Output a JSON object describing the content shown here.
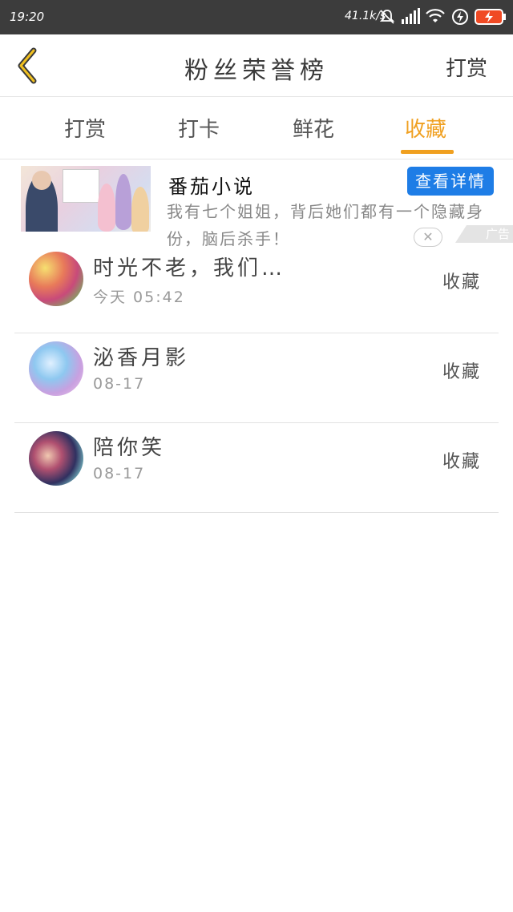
{
  "status_bar": {
    "time": "19:20",
    "network_speed": "41.1k/s",
    "icons": [
      "mute-bell-icon",
      "signal-icon",
      "wifi-icon",
      "data-saver-icon",
      "battery-charging-icon"
    ]
  },
  "header": {
    "title": "粉丝荣誉榜",
    "right_action": "打赏",
    "back_icon": "chevron-left-icon"
  },
  "tabs": [
    {
      "label": "打赏",
      "active": false
    },
    {
      "label": "打卡",
      "active": false
    },
    {
      "label": "鲜花",
      "active": false
    },
    {
      "label": "收藏",
      "active": true
    }
  ],
  "ad": {
    "title": "番茄小说",
    "description": "我有七个姐姐，背后她们都有一个隐藏身份，脑后杀手！",
    "button": "查看详情",
    "close": "✕",
    "tag": "广告"
  },
  "list": [
    {
      "name": "时光不老，我们…",
      "time": "今天 05:42",
      "action": "收藏"
    },
    {
      "name": "泌香月影",
      "time": "08-17",
      "action": "收藏"
    },
    {
      "name": "陪你笑",
      "time": "08-17",
      "action": "收藏"
    }
  ],
  "colors": {
    "accent": "#f0a020",
    "status_bar": "#3c3c3c",
    "ad_button": "#1e7de6"
  }
}
